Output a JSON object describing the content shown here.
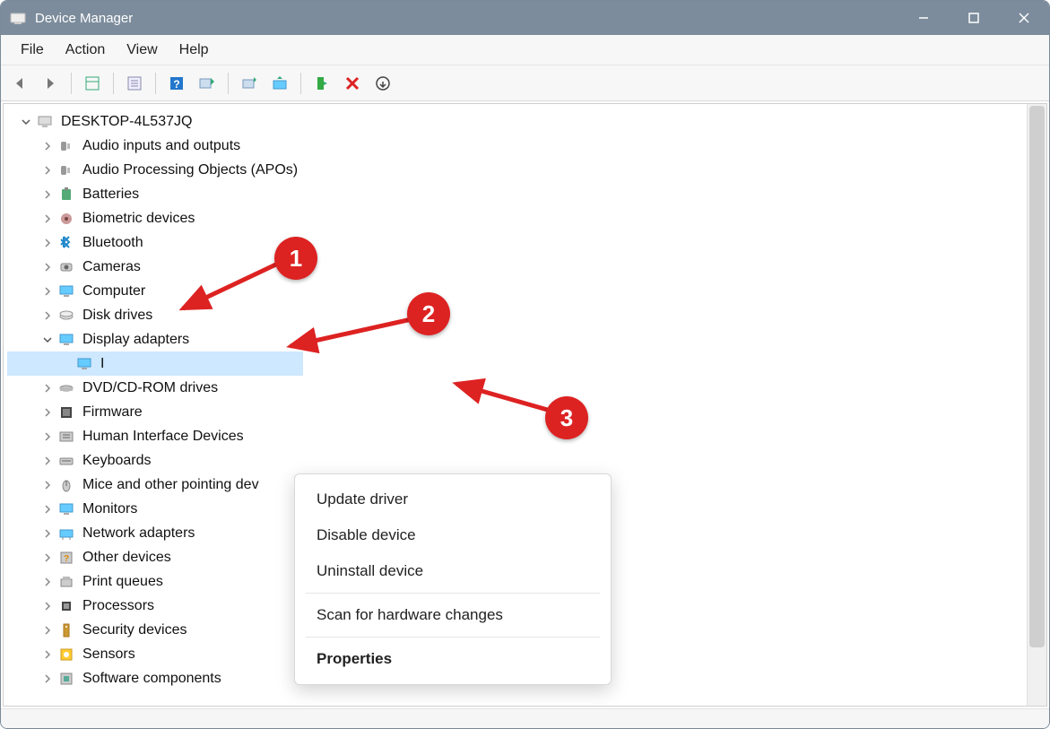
{
  "window": {
    "title": "Device Manager"
  },
  "menubar": {
    "items": [
      "File",
      "Action",
      "View",
      "Help"
    ]
  },
  "tree": {
    "root": {
      "label": "DESKTOP-4L537JQ"
    },
    "categories": [
      {
        "label": "Audio inputs and outputs"
      },
      {
        "label": "Audio Processing Objects (APOs)"
      },
      {
        "label": "Batteries"
      },
      {
        "label": "Biometric devices"
      },
      {
        "label": "Bluetooth"
      },
      {
        "label": "Cameras"
      },
      {
        "label": "Computer"
      },
      {
        "label": "Disk drives"
      },
      {
        "label": "Display adapters",
        "expanded": true,
        "children": [
          {
            "label": "I",
            "selected": true
          }
        ]
      },
      {
        "label": "DVD/CD-ROM drives"
      },
      {
        "label": "Firmware"
      },
      {
        "label": "Human Interface Devices"
      },
      {
        "label": "Keyboards"
      },
      {
        "label": "Mice and other pointing dev"
      },
      {
        "label": "Monitors"
      },
      {
        "label": "Network adapters"
      },
      {
        "label": "Other devices"
      },
      {
        "label": "Print queues"
      },
      {
        "label": "Processors"
      },
      {
        "label": "Security devices"
      },
      {
        "label": "Sensors"
      },
      {
        "label": "Software components"
      }
    ]
  },
  "context_menu": {
    "items": [
      {
        "label": "Update driver"
      },
      {
        "label": "Disable device"
      },
      {
        "label": "Uninstall device"
      },
      {
        "sep": true
      },
      {
        "label": "Scan for hardware changes"
      },
      {
        "sep": true
      },
      {
        "label": "Properties",
        "bold": true
      }
    ]
  },
  "annotations": {
    "b1": "1",
    "b2": "2",
    "b3": "3"
  }
}
